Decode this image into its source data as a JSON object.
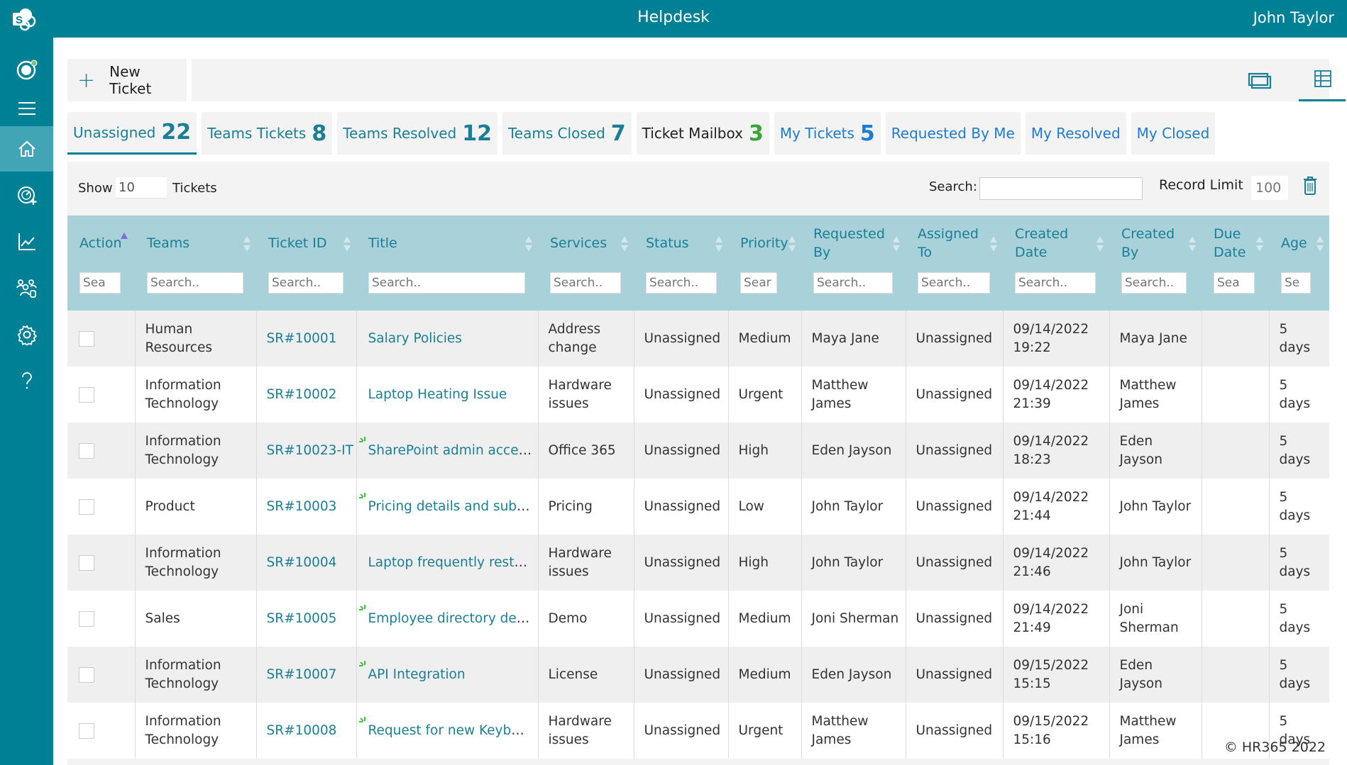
{
  "header": {
    "title": "Helpdesk",
    "user": "John Taylor"
  },
  "sidebar": {
    "items": [
      {
        "name": "teams",
        "icon": "teams-icon"
      },
      {
        "name": "menu",
        "icon": "hamburger-icon"
      },
      {
        "name": "home",
        "icon": "home-icon",
        "active": true
      },
      {
        "name": "dashboard",
        "icon": "gauge-add-icon"
      },
      {
        "name": "reports",
        "icon": "chart-icon"
      },
      {
        "name": "users",
        "icon": "people-icon"
      },
      {
        "name": "settings",
        "icon": "gear-icon"
      },
      {
        "name": "help",
        "icon": "question-icon"
      }
    ]
  },
  "toolbar": {
    "new_ticket": "New Ticket",
    "view_icons": [
      "card-view-icon",
      "table-view-icon",
      "refresh-icon"
    ]
  },
  "tabs": [
    {
      "label": "Unassigned",
      "count": "22",
      "active": true
    },
    {
      "label": "Teams Tickets",
      "count": "8"
    },
    {
      "label": "Teams Resolved",
      "count": "12"
    },
    {
      "label": "Teams Closed",
      "count": "7"
    },
    {
      "label": "Ticket Mailbox",
      "count": "3"
    },
    {
      "label": "My Tickets",
      "count": "5"
    },
    {
      "label": "Requested By Me",
      "count": ""
    },
    {
      "label": "My Resolved",
      "count": ""
    },
    {
      "label": "My Closed",
      "count": ""
    }
  ],
  "colors": {
    "brand": "#008094",
    "header_row": "#a9d1d9",
    "tab_teal": "#1a7f96",
    "tab_blue": "#1e7bd4",
    "mailbox_green": "#3aa33a"
  },
  "controls": {
    "show_label": "Show",
    "show_value": "10",
    "tickets_label": "Tickets",
    "search_label": "Search:",
    "search_value": "",
    "record_limit_label": "Record Limit",
    "record_limit_value": "100"
  },
  "table": {
    "columns": [
      "Action",
      "Teams",
      "Ticket ID",
      "Title",
      "Services",
      "Status",
      "Priority",
      "Requested By",
      "Assigned To",
      "Created Date",
      "Created By",
      "Due Date",
      "Age"
    ],
    "search_placeholders": [
      "Sea",
      "Search..",
      "Search..",
      "Search..",
      "Search..",
      "Search..",
      "Sear",
      "Search..",
      "Search..",
      "Search..",
      "Search..",
      "Sea",
      "Se"
    ],
    "rows": [
      {
        "team": "Human Resources",
        "id": "SR#10001",
        "title": "Salary Policies",
        "is_new": false,
        "service": "Address change",
        "status": "Unassigned",
        "priority": "Medium",
        "requested_by": "Maya Jane",
        "assigned_to": "Unassigned",
        "created_date": "09/14/2022 19:22",
        "created_by": "Maya Jane",
        "due_date": "",
        "age": "5 days"
      },
      {
        "team": "Information Technology",
        "id": "SR#10002",
        "title": "Laptop Heating Issue",
        "is_new": false,
        "service": "Hardware issues",
        "status": "Unassigned",
        "priority": "Urgent",
        "requested_by": "Matthew James",
        "assigned_to": "Unassigned",
        "created_date": "09/14/2022 21:39",
        "created_by": "Matthew James",
        "due_date": "",
        "age": "5 days"
      },
      {
        "team": "Information Technology",
        "id": "SR#10023-IT",
        "title": "SharePoint admin access",
        "is_new": true,
        "service": "Office 365",
        "status": "Unassigned",
        "priority": "High",
        "requested_by": "Eden Jayson",
        "assigned_to": "Unassigned",
        "created_date": "09/14/2022 18:23",
        "created_by": "Eden Jayson",
        "due_date": "",
        "age": "5 days"
      },
      {
        "team": "Product",
        "id": "SR#10003",
        "title": "Pricing details and subscript",
        "is_new": true,
        "service": "Pricing",
        "status": "Unassigned",
        "priority": "Low",
        "requested_by": "John Taylor",
        "assigned_to": "Unassigned",
        "created_date": "09/14/2022 21:44",
        "created_by": "John Taylor",
        "due_date": "",
        "age": "5 days"
      },
      {
        "team": "Information Technology",
        "id": "SR#10004",
        "title": "Laptop frequently restar...",
        "is_new": false,
        "service": "Hardware issues",
        "status": "Unassigned",
        "priority": "High",
        "requested_by": "John Taylor",
        "assigned_to": "Unassigned",
        "created_date": "09/14/2022 21:46",
        "created_by": "John Taylor",
        "due_date": "",
        "age": "5 days"
      },
      {
        "team": "Sales",
        "id": "SR#10005",
        "title": "Employee directory demo",
        "is_new": true,
        "service": "Demo",
        "status": "Unassigned",
        "priority": "Medium",
        "requested_by": "Joni Sherman",
        "assigned_to": "Unassigned",
        "created_date": "09/14/2022 21:49",
        "created_by": "Joni Sherman",
        "due_date": "",
        "age": "5 days"
      },
      {
        "team": "Information Technology",
        "id": "SR#10007",
        "title": "API Integration",
        "is_new": true,
        "service": "License",
        "status": "Unassigned",
        "priority": "Medium",
        "requested_by": "Eden Jayson",
        "assigned_to": "Unassigned",
        "created_date": "09/15/2022 15:15",
        "created_by": "Eden Jayson",
        "due_date": "",
        "age": "5 days"
      },
      {
        "team": "Information Technology",
        "id": "SR#10008",
        "title": "Request for new Keyboard...",
        "is_new": true,
        "service": "Hardware issues",
        "status": "Unassigned",
        "priority": "Urgent",
        "requested_by": "Matthew James",
        "assigned_to": "Unassigned",
        "created_date": "09/15/2022 15:16",
        "created_by": "Matthew James",
        "due_date": "",
        "age": "5 days"
      }
    ]
  },
  "footer": {
    "copyright": "© HR365 2022"
  }
}
